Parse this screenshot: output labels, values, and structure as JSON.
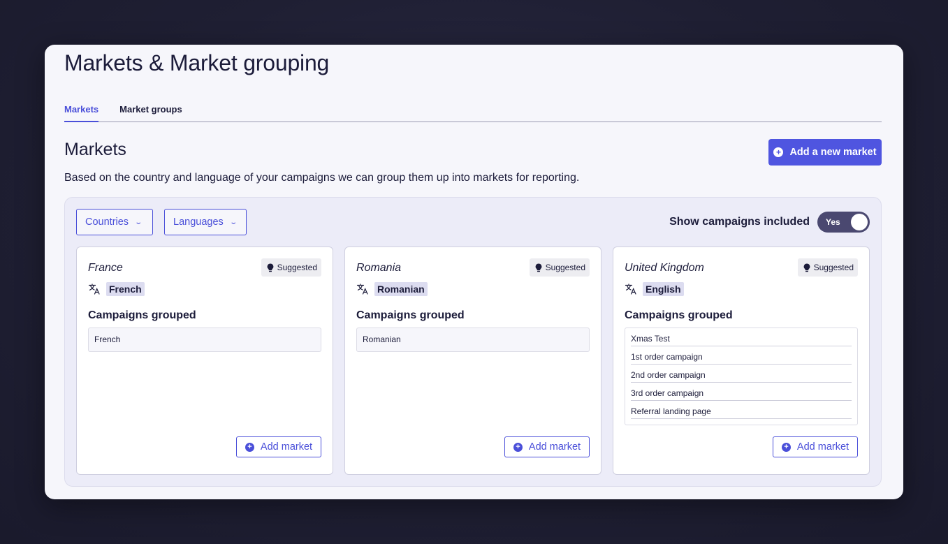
{
  "page": {
    "title": "Markets & Market grouping",
    "tabs": [
      {
        "label": "Markets",
        "active": true
      },
      {
        "label": "Market groups",
        "active": false
      }
    ]
  },
  "section": {
    "title": "Markets",
    "add_button_label": "Add a new market",
    "description": "Based on the country and language of your campaigns we can group them up into markets for reporting."
  },
  "filters": {
    "countries_label": "Countries",
    "languages_label": "Languages",
    "show_campaigns_label": "Show campaigns included",
    "toggle_value": "Yes"
  },
  "cards": [
    {
      "name": "France",
      "badge": "Suggested",
      "language": "French",
      "campaigns_title": "Campaigns grouped",
      "campaigns": [
        "French"
      ],
      "add_label": "Add market"
    },
    {
      "name": "Romania",
      "badge": "Suggested",
      "language": "Romanian",
      "campaigns_title": "Campaigns grouped",
      "campaigns": [
        "Romanian"
      ],
      "add_label": "Add market"
    },
    {
      "name": "United Kingdom",
      "badge": "Suggested",
      "language": "English",
      "campaigns_title": "Campaigns grouped",
      "campaigns": [
        "Xmas Test",
        "1st order campaign",
        "2nd order campaign",
        "3rd order campaign",
        "Referral landing page"
      ],
      "add_label": "Add market"
    }
  ],
  "colors": {
    "accent": "#4f55e0",
    "toggle_bg": "#4a4870"
  }
}
